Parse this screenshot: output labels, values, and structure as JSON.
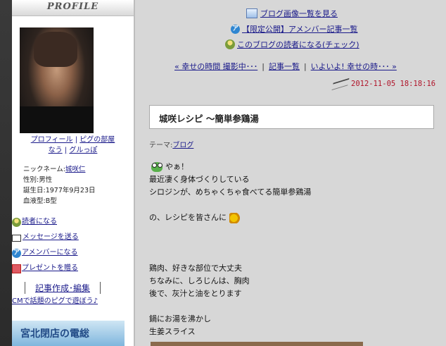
{
  "sidebar": {
    "title": "PROFILE",
    "profile_links_row1": [
      "プロフィール",
      "ピグの部屋"
    ],
    "profile_links_row2": [
      "なう",
      "グルっぽ"
    ],
    "nickname_label": "ニックネーム:",
    "nickname": "城咲仁",
    "gender": "性別:男性",
    "birthday": "誕生日:1977年9月23日",
    "blood_type": "血液型:B型",
    "actions": [
      "読者になる",
      "メッセージを送る",
      "アメンバーになる",
      "プレゼントを贈る"
    ],
    "edit_link": "記事作成･編集",
    "cm_text": "CMで話題のピグで遊ぼう♪",
    "banner_text": "宮北閉店の電総"
  },
  "top_links": {
    "image_list": "ブログ画像一覧を見る",
    "limited_list": "【限定公開】アメンバー記事一覧",
    "become_reader": "このブログの読者になる(チェック)"
  },
  "nav": {
    "prev": "« 幸せの時間 撮影中･･･",
    "list": "記事一覧",
    "next": "いよいよ! 幸せの時･･･ »"
  },
  "post": {
    "date": "2012-11-05 18:18:16",
    "title": "城咲レシピ ～簡単参鶏湯",
    "theme_label": "テーマ:",
    "theme": "ブログ",
    "lines": {
      "l1": "やぁ！",
      "l2": "最近凄く身体づくりしている",
      "l3": "シロジンが、めちゃくちゃ食べてる簡単参鶏湯",
      "l4": "の、レシピを皆さんに",
      "l5": "鶏肉、好きな部位で大丈夫",
      "l6": "ちなみに、しろじんは、胸肉",
      "l7": "後で、灰汁と油をとります",
      "l8": "鍋にお湯を沸かし",
      "l9": "生姜スライス"
    }
  }
}
